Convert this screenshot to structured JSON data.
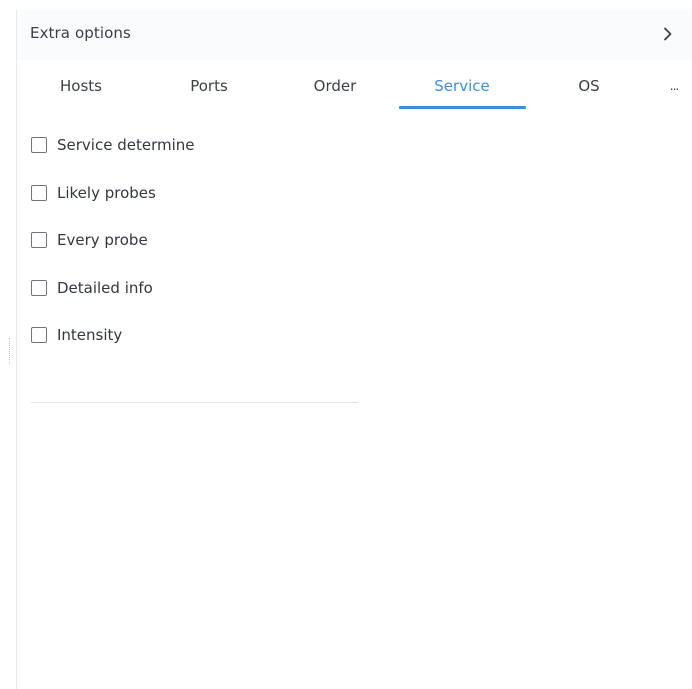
{
  "header": {
    "title": "Extra options",
    "expand_icon": "chevron-right-icon"
  },
  "tabs": [
    {
      "label": "Hosts",
      "active": false
    },
    {
      "label": "Ports",
      "active": false
    },
    {
      "label": "Order",
      "active": false
    },
    {
      "label": "Service",
      "active": true
    },
    {
      "label": "OS",
      "active": false
    },
    {
      "label": "...",
      "active": false
    }
  ],
  "options": [
    {
      "label": "Service determine",
      "checked": false
    },
    {
      "label": "Likely probes",
      "checked": false
    },
    {
      "label": "Every probe",
      "checked": false
    },
    {
      "label": "Detailed info",
      "checked": false
    },
    {
      "label": "Intensity",
      "checked": false
    }
  ],
  "colors": {
    "accent": "#3a8fe0",
    "text": "#33373e",
    "header_bg": "#fafbfc"
  }
}
